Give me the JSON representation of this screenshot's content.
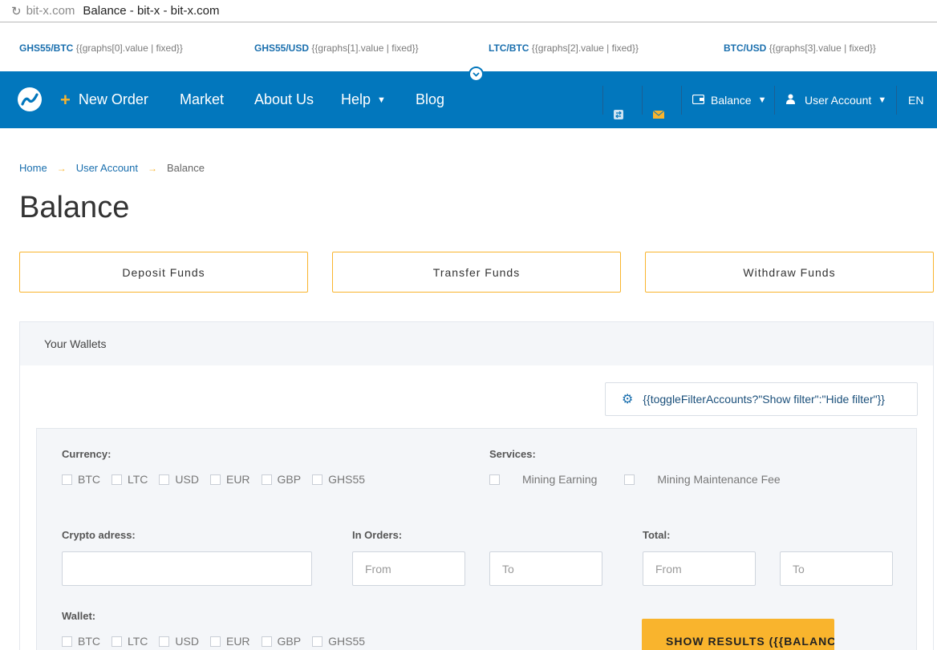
{
  "browser": {
    "domain": "bit-x.com",
    "title": "Balance - bit-x - bit-x.com"
  },
  "ticker": [
    {
      "pair": "GHS55/BTC",
      "value": "{{graphs[0].value | fixed}}"
    },
    {
      "pair": "GHS55/USD",
      "value": "{{graphs[1].value | fixed}}"
    },
    {
      "pair": "LTC/BTC",
      "value": "{{graphs[2].value | fixed}}"
    },
    {
      "pair": "BTC/USD",
      "value": "{{graphs[3].value | fixed}}"
    }
  ],
  "nav": {
    "new_order": "New Order",
    "market": "Market",
    "about": "About Us",
    "help": "Help",
    "blog": "Blog",
    "balance": "Balance",
    "user_account": "User Account",
    "language": "EN"
  },
  "breadcrumb": {
    "home": "Home",
    "user_account": "User Account",
    "current": "Balance"
  },
  "page": {
    "title": "Balance"
  },
  "actions": {
    "deposit": "Deposit Funds",
    "transfer": "Transfer Funds",
    "withdraw": "Withdraw Funds"
  },
  "wallets": {
    "header": "Your Wallets",
    "filter_toggle": "{{toggleFilterAccounts?\"Show filter\":\"Hide filter\"}}"
  },
  "filter": {
    "currency_label": "Currency:",
    "currencies": [
      "BTC",
      "LTC",
      "USD",
      "EUR",
      "GBP",
      "GHS55"
    ],
    "services_label": "Services:",
    "services": [
      "Mining Earning",
      "Mining Maintenance Fee"
    ],
    "crypto_label": "Crypto adress:",
    "in_orders_label": "In Orders:",
    "total_label": "Total:",
    "from_placeholder": "From",
    "to_placeholder": "To",
    "wallet_label": "Wallet:",
    "wallets": [
      "BTC",
      "LTC",
      "USD",
      "EUR",
      "GBP",
      "GHS55"
    ],
    "show_results": "SHOW RESULTS ({{BALANCE"
  },
  "colors": {
    "brand_blue": "#0277bd",
    "accent_yellow": "#f9b42d",
    "link_blue": "#1a6fae"
  }
}
